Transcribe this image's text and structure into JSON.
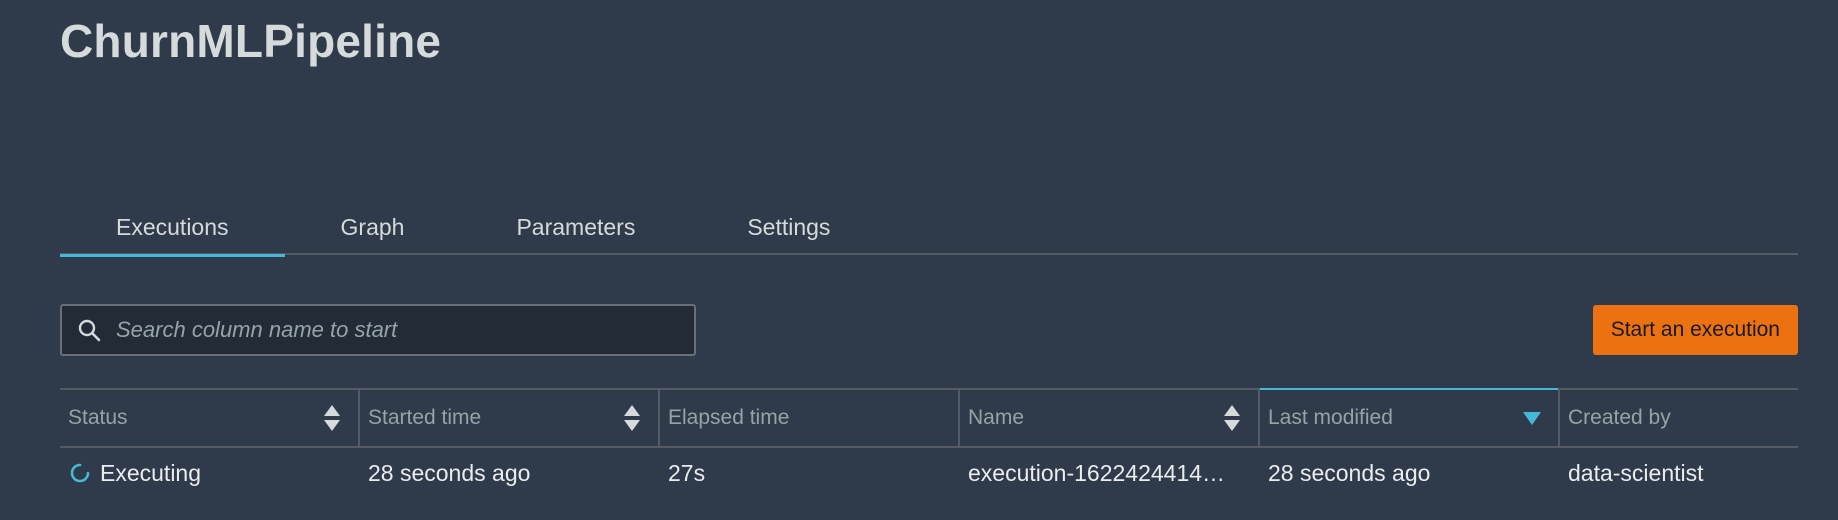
{
  "page": {
    "title": "ChurnMLPipeline"
  },
  "tabs": [
    {
      "label": "Executions",
      "active": true
    },
    {
      "label": "Graph",
      "active": false
    },
    {
      "label": "Parameters",
      "active": false
    },
    {
      "label": "Settings",
      "active": false
    }
  ],
  "toolbar": {
    "search_placeholder": "Search column name to start",
    "search_value": "",
    "search_icon": "search-icon",
    "start_button_label": "Start an execution"
  },
  "table": {
    "columns": [
      {
        "label": "Status",
        "sort": "sortable"
      },
      {
        "label": "Started time",
        "sort": "sortable"
      },
      {
        "label": "Elapsed time",
        "sort": "none"
      },
      {
        "label": "Name",
        "sort": "sortable"
      },
      {
        "label": "Last modified",
        "sort": "descending"
      },
      {
        "label": "Created by",
        "sort": "none"
      }
    ],
    "rows": [
      {
        "status": "Executing",
        "status_icon": "spinner-icon",
        "started_time": "28 seconds ago",
        "elapsed_time": "27s",
        "name": "execution-1622424414…",
        "last_modified": "28 seconds ago",
        "created_by": "data-scientist"
      }
    ]
  },
  "colors": {
    "background": "#2f3a4b",
    "accent": "#44b9d6",
    "primary_button": "#ec7211",
    "text": "#d5dbdb",
    "muted_text": "#95a5a6",
    "border": "#545b64"
  }
}
